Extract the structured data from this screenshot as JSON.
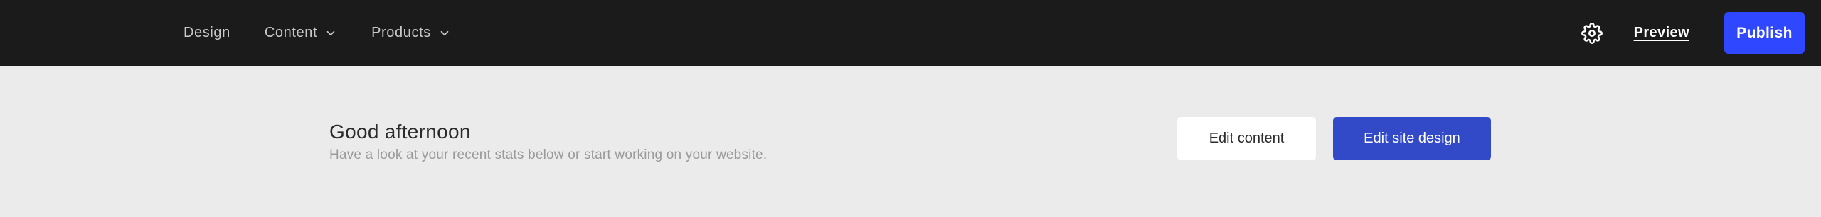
{
  "header": {
    "nav_items": [
      {
        "label": "Design",
        "has_dropdown": false
      },
      {
        "label": "Content",
        "has_dropdown": true
      },
      {
        "label": "Products",
        "has_dropdown": true
      }
    ],
    "settings_icon": "gear-icon",
    "preview_label": "Preview",
    "publish_label": "Publish"
  },
  "main": {
    "greeting_title": "Good afternoon",
    "greeting_subtitle": "Have a look at your recent stats below or start working on your website.",
    "edit_content_label": "Edit content",
    "edit_site_design_label": "Edit site design"
  },
  "colors": {
    "topbar_bg": "#1b1b1b",
    "page_bg": "#ebebeb",
    "publish_bg": "#2f47ff",
    "primary_btn_bg": "#3249c8",
    "secondary_btn_bg": "#ffffff"
  }
}
